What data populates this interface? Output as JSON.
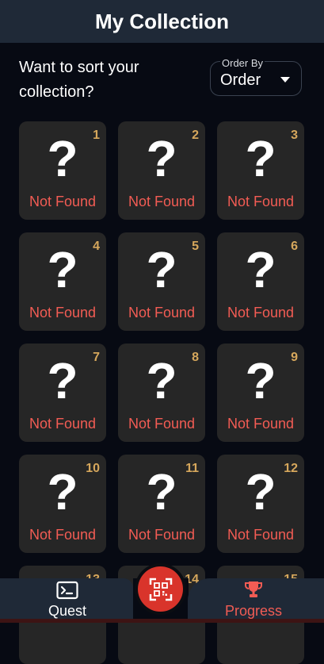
{
  "header": {
    "title": "My Collection"
  },
  "sort": {
    "prompt": "Want to sort your collection?",
    "select_label": "Order By",
    "select_value": "Order"
  },
  "cards": [
    {
      "number": "1",
      "symbol": "?",
      "status": "Not Found"
    },
    {
      "number": "2",
      "symbol": "?",
      "status": "Not Found"
    },
    {
      "number": "3",
      "symbol": "?",
      "status": "Not Found"
    },
    {
      "number": "4",
      "symbol": "?",
      "status": "Not Found"
    },
    {
      "number": "5",
      "symbol": "?",
      "status": "Not Found"
    },
    {
      "number": "6",
      "symbol": "?",
      "status": "Not Found"
    },
    {
      "number": "7",
      "symbol": "?",
      "status": "Not Found"
    },
    {
      "number": "8",
      "symbol": "?",
      "status": "Not Found"
    },
    {
      "number": "9",
      "symbol": "?",
      "status": "Not Found"
    },
    {
      "number": "10",
      "symbol": "?",
      "status": "Not Found"
    },
    {
      "number": "11",
      "symbol": "?",
      "status": "Not Found"
    },
    {
      "number": "12",
      "symbol": "?",
      "status": "Not Found"
    },
    {
      "number": "13",
      "symbol": "?",
      "status": ""
    },
    {
      "number": "14",
      "symbol": "?",
      "status": ""
    },
    {
      "number": "15",
      "symbol": "?",
      "status": ""
    }
  ],
  "nav": {
    "quest_label": "Quest",
    "progress_label": "Progress",
    "quest_icon": "terminal-icon",
    "scan_icon": "qr-code-icon",
    "progress_icon": "trophy-icon"
  },
  "colors": {
    "accent": "#d9342b",
    "number": "#d6a75c",
    "status": "#f25c54",
    "header": "#1f2937",
    "card": "#262626"
  }
}
